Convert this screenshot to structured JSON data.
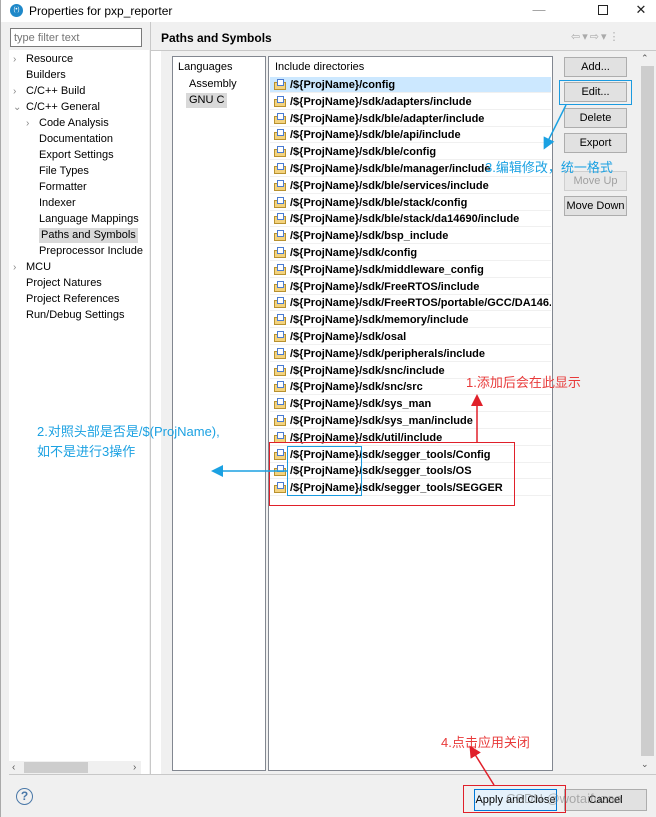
{
  "window": {
    "title": "Properties for pxp_reporter",
    "app_icon": "eclipse-app-icon",
    "controls": {
      "minimize": "—",
      "close": "✕"
    }
  },
  "filter": {
    "placeholder": "type filter text",
    "value": ""
  },
  "tree": {
    "items": [
      {
        "label": "Resource",
        "twisty": "›",
        "level": 0
      },
      {
        "label": "Builders",
        "twisty": "",
        "level": 0
      },
      {
        "label": "C/C++ Build",
        "twisty": "›",
        "level": 0
      },
      {
        "label": "C/C++ General",
        "twisty": "⌄",
        "level": 0
      },
      {
        "label": "Code Analysis",
        "twisty": "›",
        "level": 1
      },
      {
        "label": "Documentation",
        "twisty": "",
        "level": 1
      },
      {
        "label": "Export Settings",
        "twisty": "",
        "level": 1
      },
      {
        "label": "File Types",
        "twisty": "",
        "level": 1
      },
      {
        "label": "Formatter",
        "twisty": "",
        "level": 1
      },
      {
        "label": "Indexer",
        "twisty": "",
        "level": 1
      },
      {
        "label": "Language Mappings",
        "twisty": "",
        "level": 1
      },
      {
        "label": "Paths and Symbols",
        "twisty": "",
        "level": 1,
        "selected": true
      },
      {
        "label": "Preprocessor Include",
        "twisty": "",
        "level": 1
      },
      {
        "label": "MCU",
        "twisty": "›",
        "level": 0
      },
      {
        "label": "Project Natures",
        "twisty": "",
        "level": 0
      },
      {
        "label": "Project References",
        "twisty": "",
        "level": 0
      },
      {
        "label": "Run/Debug Settings",
        "twisty": "",
        "level": 0
      }
    ]
  },
  "page": {
    "title": "Paths and Symbols",
    "nav": {
      "back": "⇦",
      "back_menu": "▾",
      "forward": "⇨",
      "forward_menu": "▾",
      "more": "⋮"
    }
  },
  "languages": {
    "header": "Languages",
    "items": [
      {
        "label": "Assembly"
      },
      {
        "label": "GNU C",
        "selected": true
      }
    ]
  },
  "includes": {
    "header": "Include directories",
    "rows": [
      "/${ProjName}/config",
      "/${ProjName}/sdk/adapters/include",
      "/${ProjName}/sdk/ble/adapter/include",
      "/${ProjName}/sdk/ble/api/include",
      "/${ProjName}/sdk/ble/config",
      "/${ProjName}/sdk/ble/manager/include",
      "/${ProjName}/sdk/ble/services/include",
      "/${ProjName}/sdk/ble/stack/config",
      "/${ProjName}/sdk/ble/stack/da14690/include",
      "/${ProjName}/sdk/bsp_include",
      "/${ProjName}/sdk/config",
      "/${ProjName}/sdk/middleware_config",
      "/${ProjName}/sdk/FreeRTOS/include",
      "/${ProjName}/sdk/FreeRTOS/portable/GCC/DA146...",
      "/${ProjName}/sdk/memory/include",
      "/${ProjName}/sdk/osal",
      "/${ProjName}/sdk/peripherals/include",
      "/${ProjName}/sdk/snc/include",
      "/${ProjName}/sdk/snc/src",
      "/${ProjName}/sdk/sys_man",
      "/${ProjName}/sdk/sys_man/include",
      "/${ProjName}/sdk/util/include",
      "/${ProjName}/sdk/segger_tools/Config",
      "/${ProjName}/sdk/segger_tools/OS",
      "/${ProjName}/sdk/segger_tools/SEGGER"
    ],
    "selected_index": 0
  },
  "buttons": {
    "add": "Add...",
    "edit": "Edit...",
    "delete": "Delete",
    "export": "Export",
    "move_up": "Move Up",
    "move_down": "Move Down"
  },
  "footer": {
    "apply_close": "Apply and Close",
    "cancel": "Cancel",
    "help": "?"
  },
  "annotations": {
    "step1": "1.添加后会在此显示",
    "step2_line1": "2.对照头部是否是/$(ProjName),",
    "step2_line2": "如不是进行3操作",
    "step3": "3.编辑修改，统一格式",
    "step4": "4.点击应用关闭",
    "watermark": "CSDN @wotaifuzao"
  },
  "colors": {
    "annotation_red": "#e83a3a",
    "annotation_blue": "#1ba1e2",
    "selection": "#cce8ff",
    "default_button_border": "#0078d7"
  }
}
